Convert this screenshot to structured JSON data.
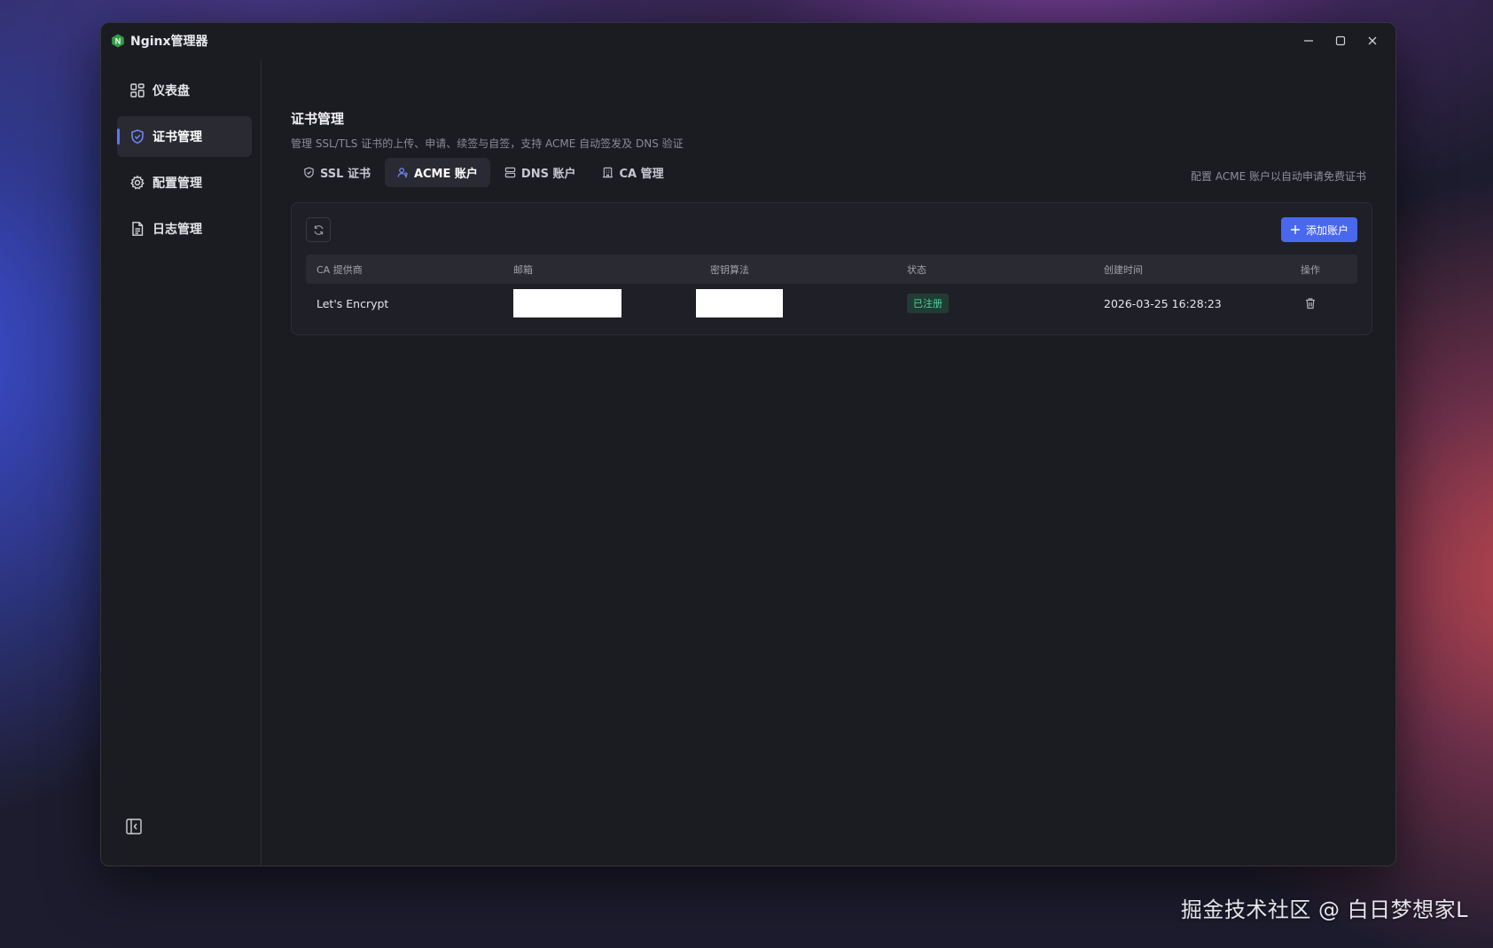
{
  "app": {
    "title": "Nginx管理器",
    "logo_letter": "N"
  },
  "sidebar": {
    "items": [
      {
        "label": "仪表盘",
        "icon": "dashboard-icon"
      },
      {
        "label": "证书管理",
        "icon": "shield-icon",
        "active": true
      },
      {
        "label": "配置管理",
        "icon": "gear-icon"
      },
      {
        "label": "日志管理",
        "icon": "document-icon"
      }
    ]
  },
  "page": {
    "title": "证书管理",
    "subtitle": "管理 SSL/TLS 证书的上传、申请、续签与自签，支持 ACME 自动签发及 DNS 验证",
    "hint": "配置 ACME 账户以自动申请免费证书"
  },
  "tabs": [
    {
      "label": "SSL 证书",
      "icon": "shield-icon"
    },
    {
      "label": "ACME 账户",
      "icon": "user-key-icon",
      "active": true
    },
    {
      "label": "DNS 账户",
      "icon": "server-icon"
    },
    {
      "label": "CA 管理",
      "icon": "building-icon"
    }
  ],
  "toolbar": {
    "add_label": "添加账户"
  },
  "table": {
    "headers": [
      "CA 提供商",
      "邮箱",
      "密钥算法",
      "状态",
      "创建时间",
      "操作"
    ],
    "rows": [
      {
        "provider": "Let's Encrypt",
        "email": "",
        "algorithm": "",
        "status": "已注册",
        "created": "2026-03-25 16:28:23"
      }
    ]
  },
  "colors": {
    "accent": "#4a68ee",
    "status_ok": "#4fd39a",
    "logo": "#2f9e44"
  },
  "watermark": "掘金技术社区 @ 白日梦想家L"
}
